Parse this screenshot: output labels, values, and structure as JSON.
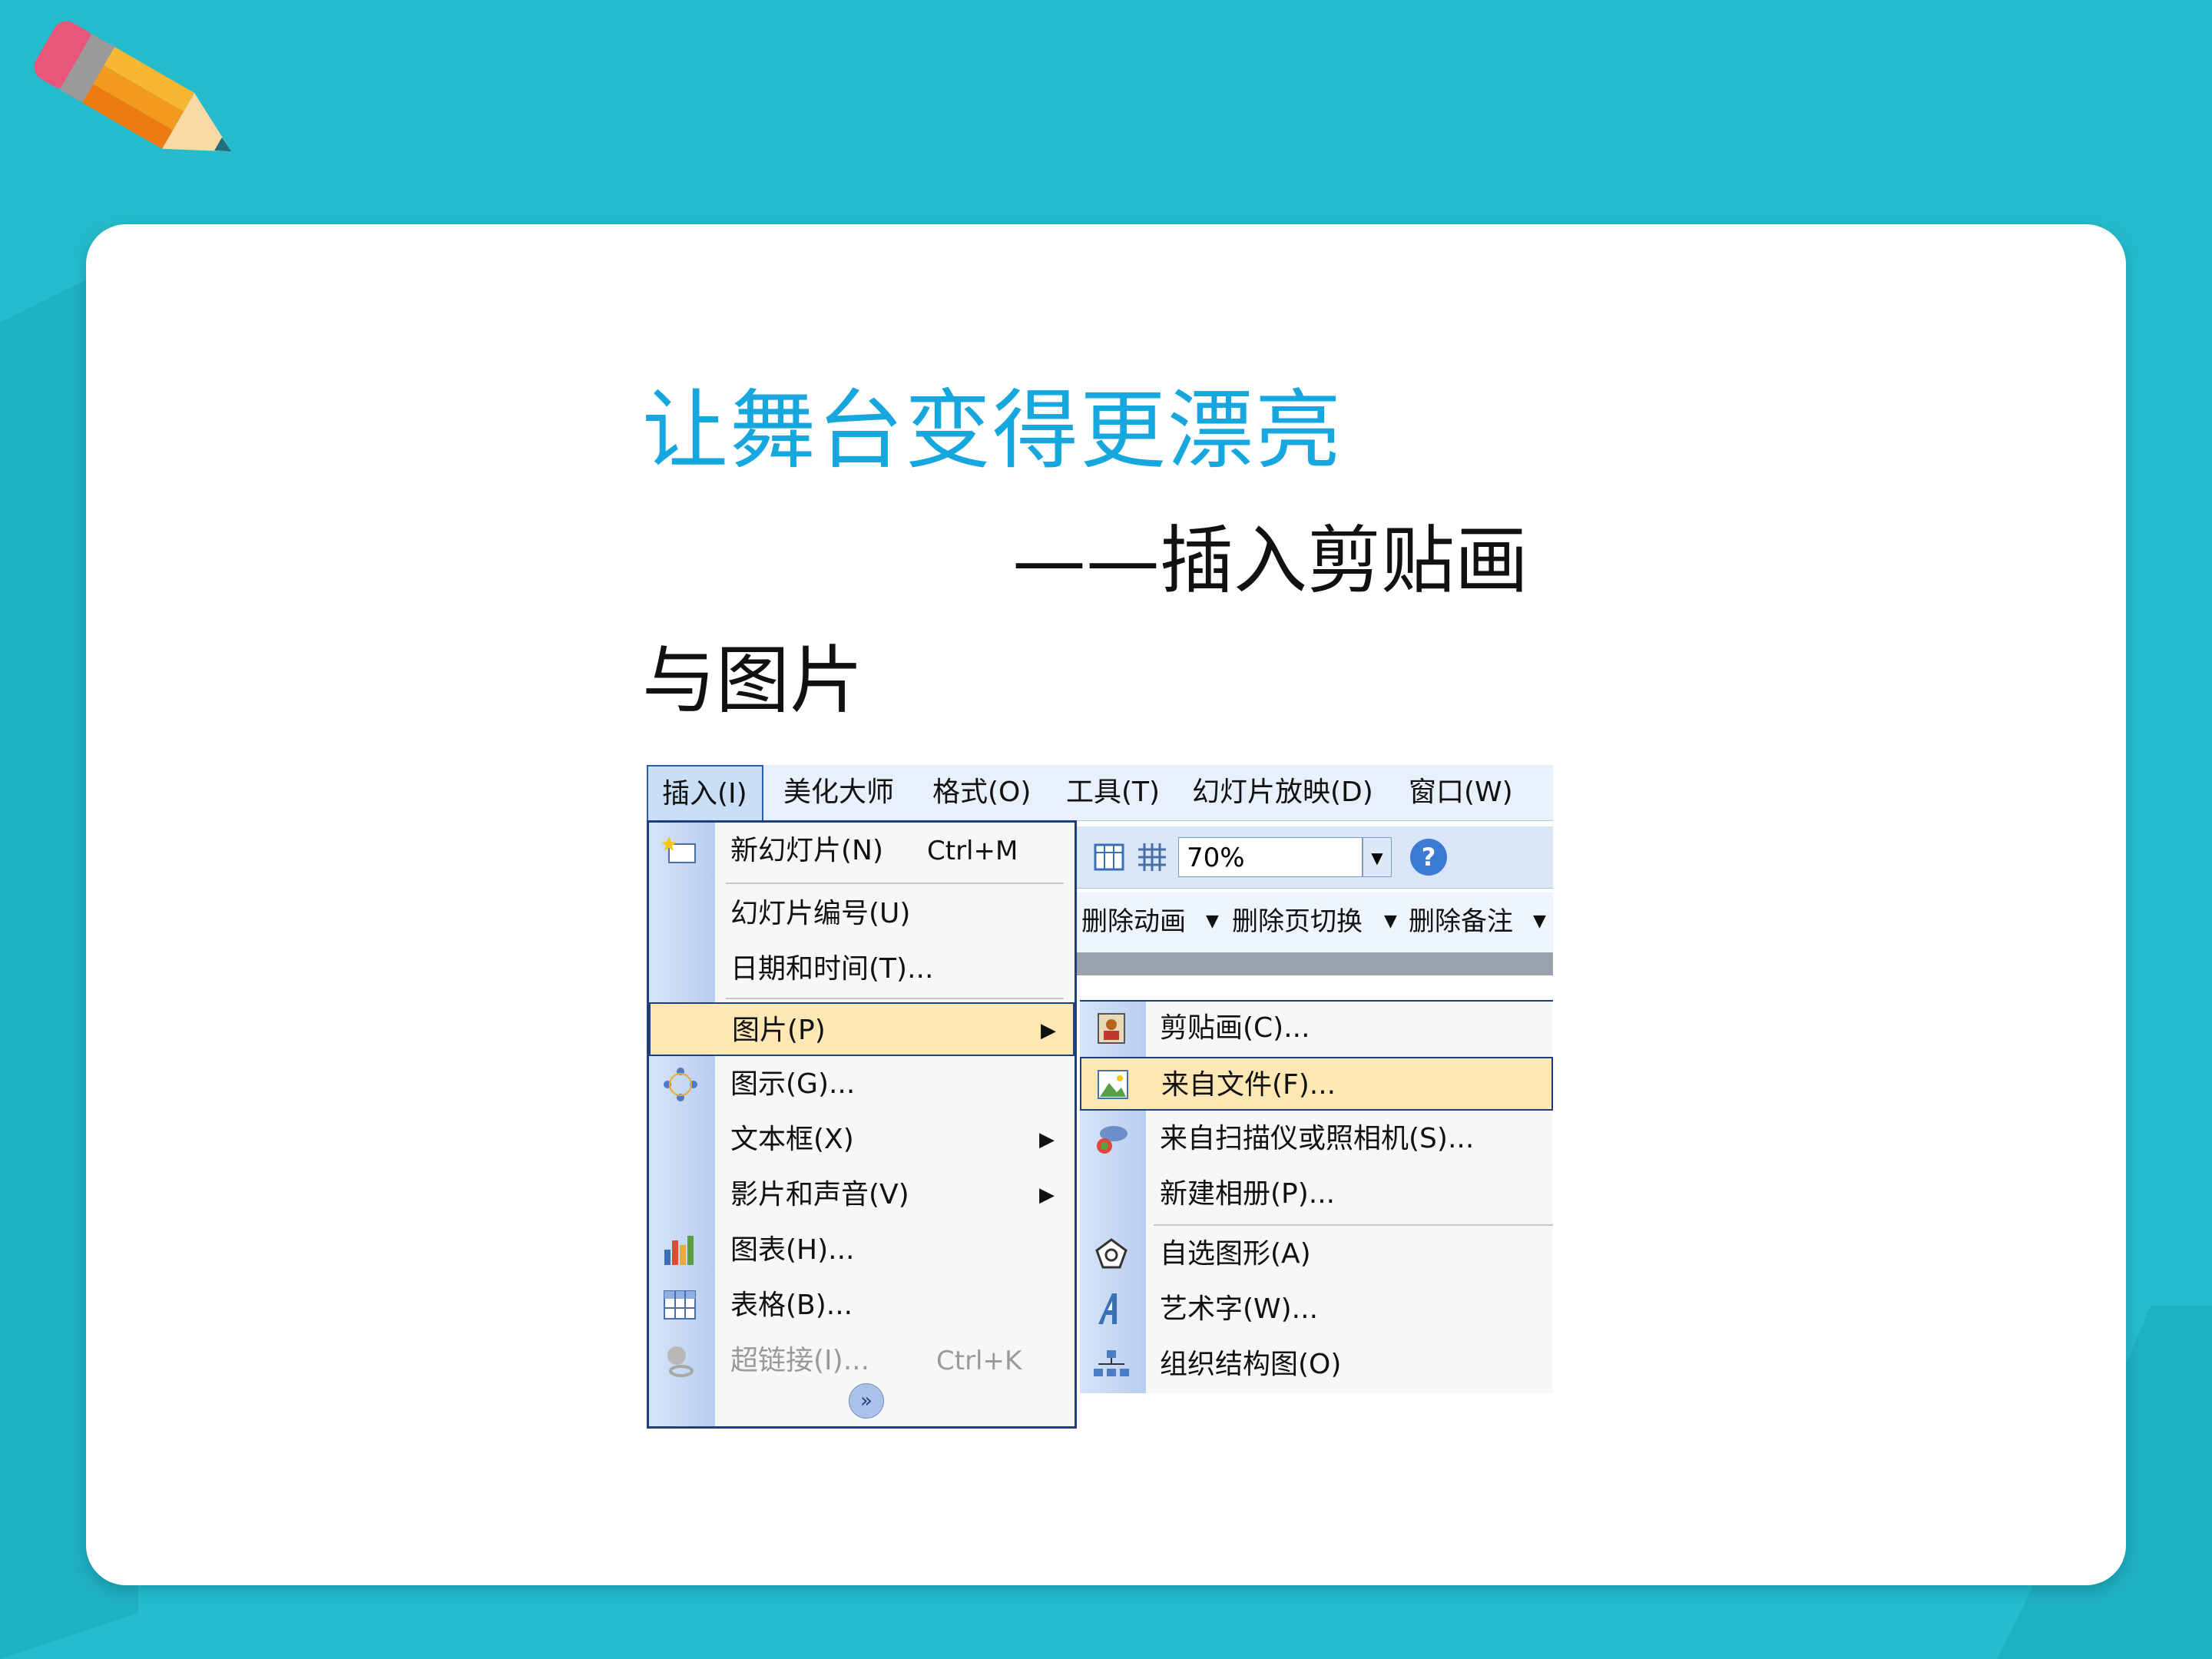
{
  "slide": {
    "title": "让舞台变得更漂亮",
    "subtitle_line1": "——插入剪贴画",
    "subtitle_line2": "与图片"
  },
  "menubar": {
    "items": [
      "插入(I)",
      "美化大师",
      "格式(O)",
      "工具(T)",
      "幻灯片放映(D)",
      "窗口(W)"
    ]
  },
  "toolbar": {
    "zoom": "70%",
    "buttons": [
      "删除动画",
      "删除页切换",
      "删除备注"
    ]
  },
  "insert_menu": {
    "items": [
      {
        "label": "新幻灯片(N)",
        "shortcut": "Ctrl+M"
      },
      {
        "label": "幻灯片编号(U)"
      },
      {
        "label": "日期和时间(T)..."
      },
      {
        "label": "图片(P)"
      },
      {
        "label": "图示(G)..."
      },
      {
        "label": "文本框(X)"
      },
      {
        "label": "影片和声音(V)"
      },
      {
        "label": "图表(H)..."
      },
      {
        "label": "表格(B)..."
      },
      {
        "label": "超链接(I)...",
        "shortcut": "Ctrl+K"
      }
    ]
  },
  "picture_submenu": {
    "items": [
      "剪贴画(C)...",
      "来自文件(F)...",
      "来自扫描仪或照相机(S)...",
      "新建相册(P)...",
      "自选图形(A)",
      "艺术字(W)...",
      "组织结构图(O)"
    ]
  },
  "colors": {
    "background": "#24bccd",
    "title": "#17a7df",
    "highlight": "#fde7b5"
  }
}
